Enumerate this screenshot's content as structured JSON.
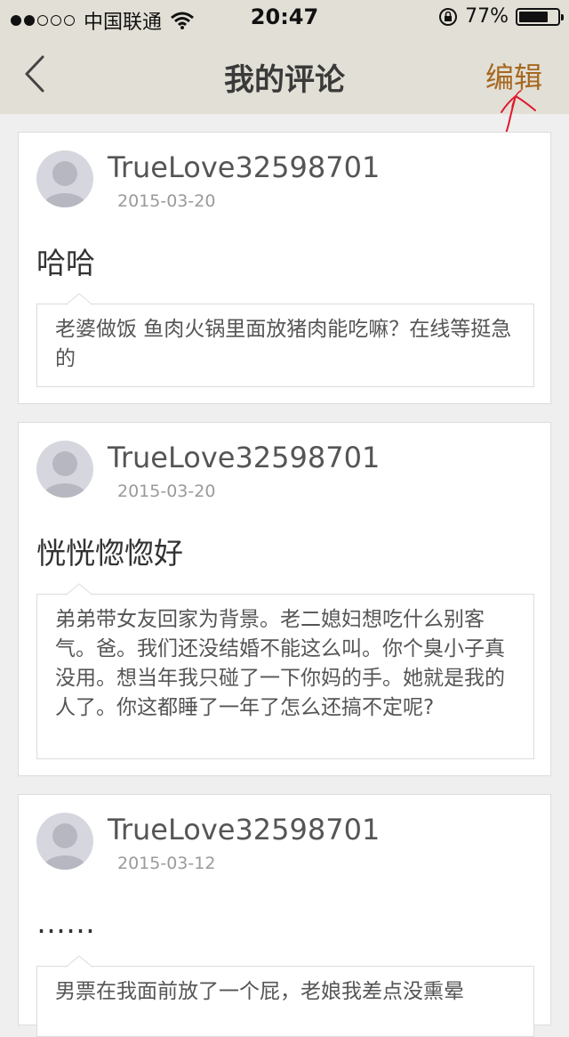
{
  "status_bar": {
    "carrier": "中国联通",
    "time": "20:47",
    "battery_percent": "77%",
    "battery_level": 0.77,
    "signal_bars_filled": 2,
    "signal_bars_total": 5
  },
  "nav": {
    "title": "我的评论",
    "edit_label": "编辑"
  },
  "colors": {
    "nav_background": "#e2dfd6",
    "accent": "#a66720",
    "annotation": "#e0182d"
  },
  "comments": [
    {
      "username": "TrueLove32598701",
      "date": "2015-03-20",
      "text": "哈哈",
      "quote": "老婆做饭 鱼肉火锅里面放猪肉能吃嘛？在线等挺急的"
    },
    {
      "username": "TrueLove32598701",
      "date": "2015-03-20",
      "text": "恍恍惚惚好",
      "quote": "弟弟带女友回家为背景。老二媳妇想吃什么别客气。爸。我们还没结婚不能这么叫。你个臭小子真没用。想当年我只碰了一下你妈的手。她就是我的人了。你这都睡了一年了怎么还搞不定呢?"
    },
    {
      "username": "TrueLove32598701",
      "date": "2015-03-12",
      "text": "……",
      "quote": "男票在我面前放了一个屁，老娘我差点没熏晕"
    }
  ]
}
